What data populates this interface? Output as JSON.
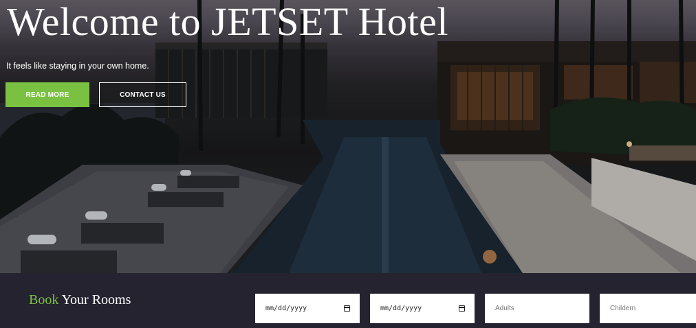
{
  "hero": {
    "title": "Welcome to JETSET Hotel",
    "subtitle": "It feels like staying in your own home.",
    "read_more_label": "READ MORE",
    "contact_label": "CONTACT US",
    "accent_color": "#7ac142"
  },
  "booking": {
    "title_accent": "Book",
    "title_rest": " Your Rooms",
    "checkin_value": "mm/dd/yyyy",
    "checkout_value": "mm/dd/yyyy",
    "adults_placeholder": "Adults",
    "children_placeholder": "Childern",
    "background_color": "#25232f"
  }
}
